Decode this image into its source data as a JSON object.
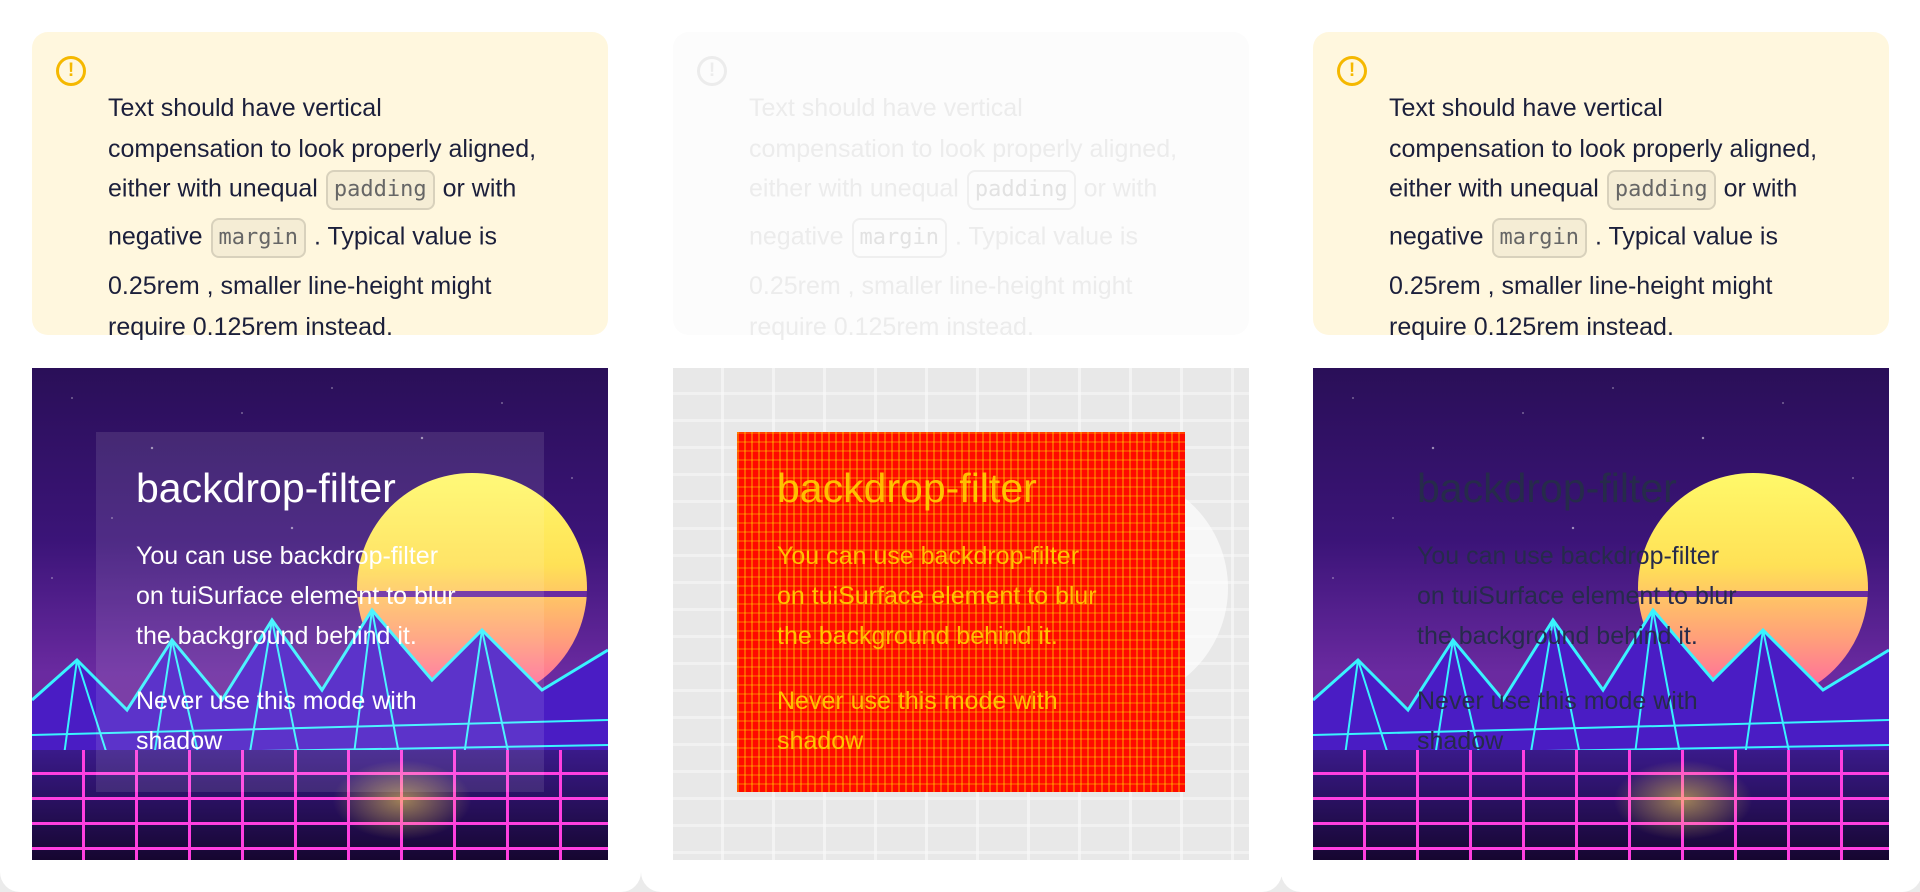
{
  "notice": {
    "icon": "exclamation-circle-icon",
    "accent_color": "#f5b800",
    "background_color": "#fff7de",
    "line1": "Text should have vertical",
    "line2": "compensation to look properly aligned,",
    "line3_before": "either with unequal",
    "code1": "padding",
    "line3_after": "or with",
    "line4_before": "negative",
    "code2": "margin",
    "line4_after": ". Typical value is",
    "line5": "0.25rem , smaller line-height might",
    "line6": "require 0.125rem instead."
  },
  "demo": {
    "title": "backdrop-filter",
    "body_line1": "You can use backdrop-filter",
    "body_line2": "on tuiSurface element to blur",
    "body_line3": "the background behind it.",
    "body_line4": "Never use this mode with",
    "body_line5": "shadow"
  },
  "colors": {
    "diff_highlight": "#ff0a00",
    "dark_text": "#262b4b"
  }
}
